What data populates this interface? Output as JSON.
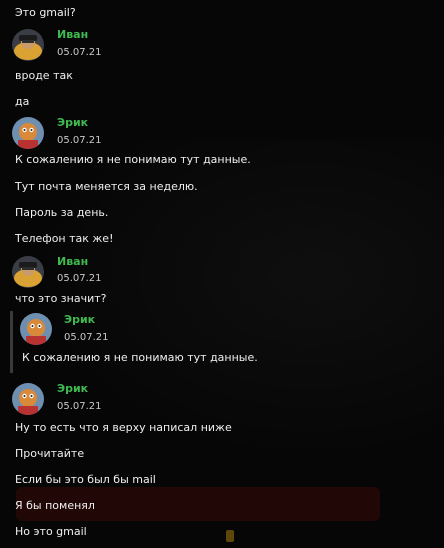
{
  "messages": [
    {
      "text": "Это gmail?"
    },
    {
      "author": "Иван",
      "date": "05.07.21",
      "lines": [
        "вроде так",
        "да"
      ]
    },
    {
      "author": "Эрик",
      "date": "05.07.21",
      "lines": [
        "К сожалению я не понимаю тут данные.",
        "Тут почта меняется за неделю.",
        "Пароль за день.",
        "Телефон так же!"
      ]
    },
    {
      "author": "Иван",
      "date": "05.07.21",
      "lines": [
        "что это значит?"
      ]
    },
    {
      "quote": {
        "author": "Эрик",
        "date": "05.07.21",
        "text": "К сожалению я не понимаю тут данные."
      }
    },
    {
      "author": "Эрик",
      "date": "05.07.21",
      "lines": [
        "Ну то есть что я верху написал ниже",
        "Прочитайте",
        "Если бы это был бы mail",
        "Я бы поменял",
        "Но это gmail"
      ]
    }
  ],
  "colors": {
    "author": "#3fb950",
    "background": "#060606",
    "text": "#f0f0f0"
  }
}
